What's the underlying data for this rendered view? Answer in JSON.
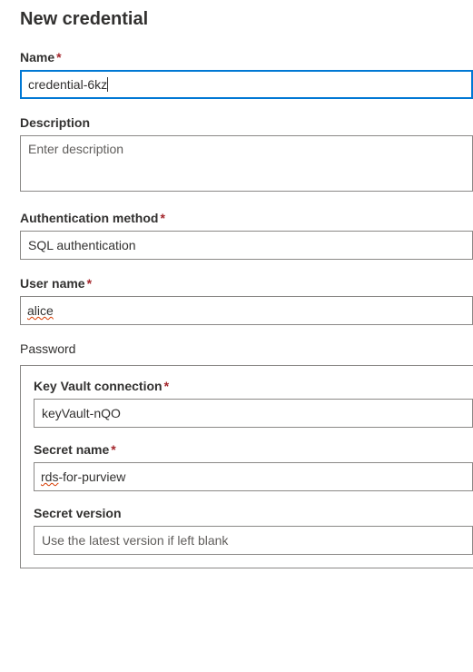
{
  "header": {
    "title": "New credential"
  },
  "form": {
    "name": {
      "label": "Name",
      "value": "credential-6kz",
      "required": true
    },
    "description": {
      "label": "Description",
      "placeholder": "Enter description",
      "value": ""
    },
    "authMethod": {
      "label": "Authentication method",
      "selected": "SQL authentication",
      "required": true
    },
    "userName": {
      "label": "User name",
      "value": "alice",
      "required": true
    },
    "passwordGroup": {
      "title": "Password",
      "keyVaultConnection": {
        "label": "Key Vault connection",
        "selected": "keyVault-nQO",
        "required": true
      },
      "secretName": {
        "label": "Secret name",
        "value_prefix": "rds",
        "value_suffix": "-for-purview",
        "required": true
      },
      "secretVersion": {
        "label": "Secret version",
        "placeholder": "Use the latest version if left blank",
        "value": ""
      }
    }
  }
}
